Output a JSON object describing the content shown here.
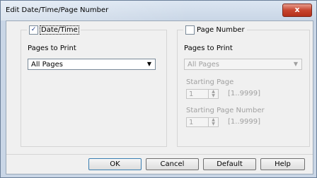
{
  "window": {
    "title": "Edit Date/Time/Page Number",
    "close_glyph": "x"
  },
  "date_time": {
    "checkbox_label": "Date/Time",
    "checked": true,
    "pages_to_print_label": "Pages to Print",
    "pages_to_print_value": "All Pages"
  },
  "page_number": {
    "checkbox_label": "Page Number",
    "checked": false,
    "pages_to_print_label": "Pages to Print",
    "pages_to_print_value": "All Pages",
    "starting_page_label": "Starting Page",
    "starting_page_value": "1",
    "starting_page_range": "[1..9999]",
    "starting_page_number_label": "Starting Page Number",
    "starting_page_number_value": "1",
    "starting_page_number_range": "[1..9999]"
  },
  "buttons": {
    "ok": "OK",
    "cancel": "Cancel",
    "default": "Default",
    "help": "Help"
  },
  "icons": {
    "dropdown": "chevron-down-icon",
    "spin": "spin-arrows-icon"
  },
  "colors": {
    "titlebar": "#c9d6e6",
    "close": "#c7452f",
    "dialog_bg": "#f0f0f0",
    "disabled_text": "#a0a0a0"
  }
}
